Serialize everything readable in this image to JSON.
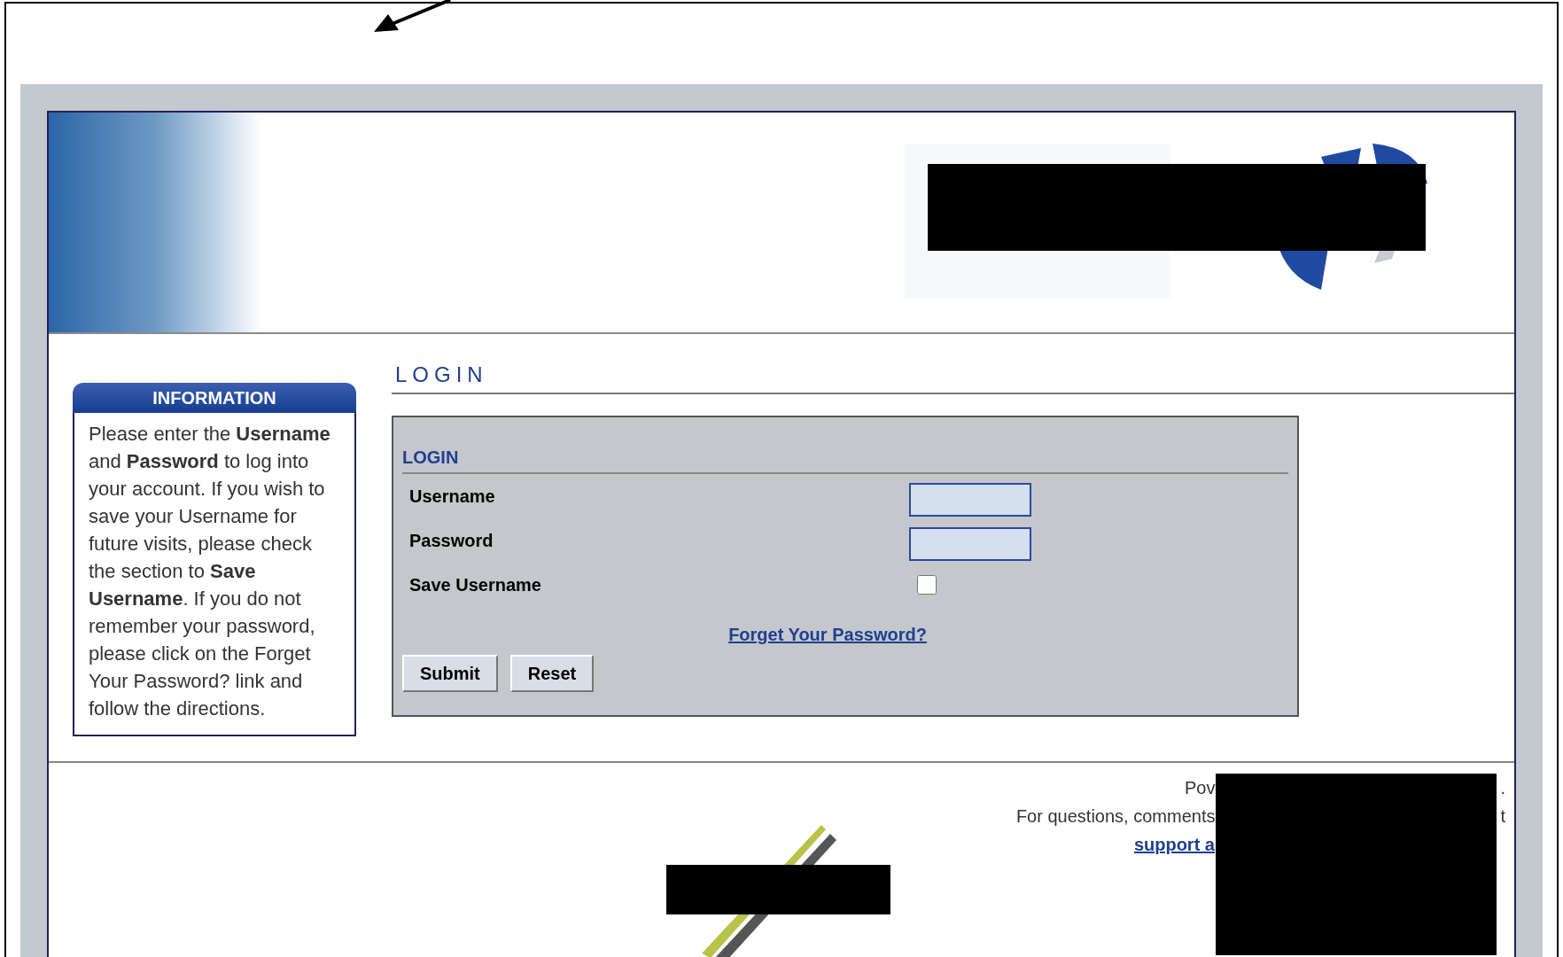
{
  "page_heading": "LOGIN",
  "information": {
    "title": "INFORMATION",
    "text": "Please enter the **Username** and **Password** to log into your account. If you wish to save your Username for future visits, please check the section to **Save Username**. If you do not remember your password, please click on the Forget Your Password? link and follow the directions."
  },
  "login_form": {
    "title": "LOGIN",
    "fields": [
      {
        "kind": "text",
        "label": "Username"
      },
      {
        "kind": "password",
        "label": "Password"
      },
      {
        "kind": "checkbox",
        "label": "Save Username",
        "checked": false
      }
    ],
    "link": "Forget Your Password?",
    "buttons": [
      "Submit",
      "Reset"
    ]
  },
  "footer": {
    "lines": [
      {
        "kind": "text",
        "before": "Pov",
        "after": "."
      },
      {
        "kind": "text",
        "before": "For questions, comments",
        "after": "t"
      },
      {
        "kind": "link",
        "before": "support a"
      }
    ]
  }
}
